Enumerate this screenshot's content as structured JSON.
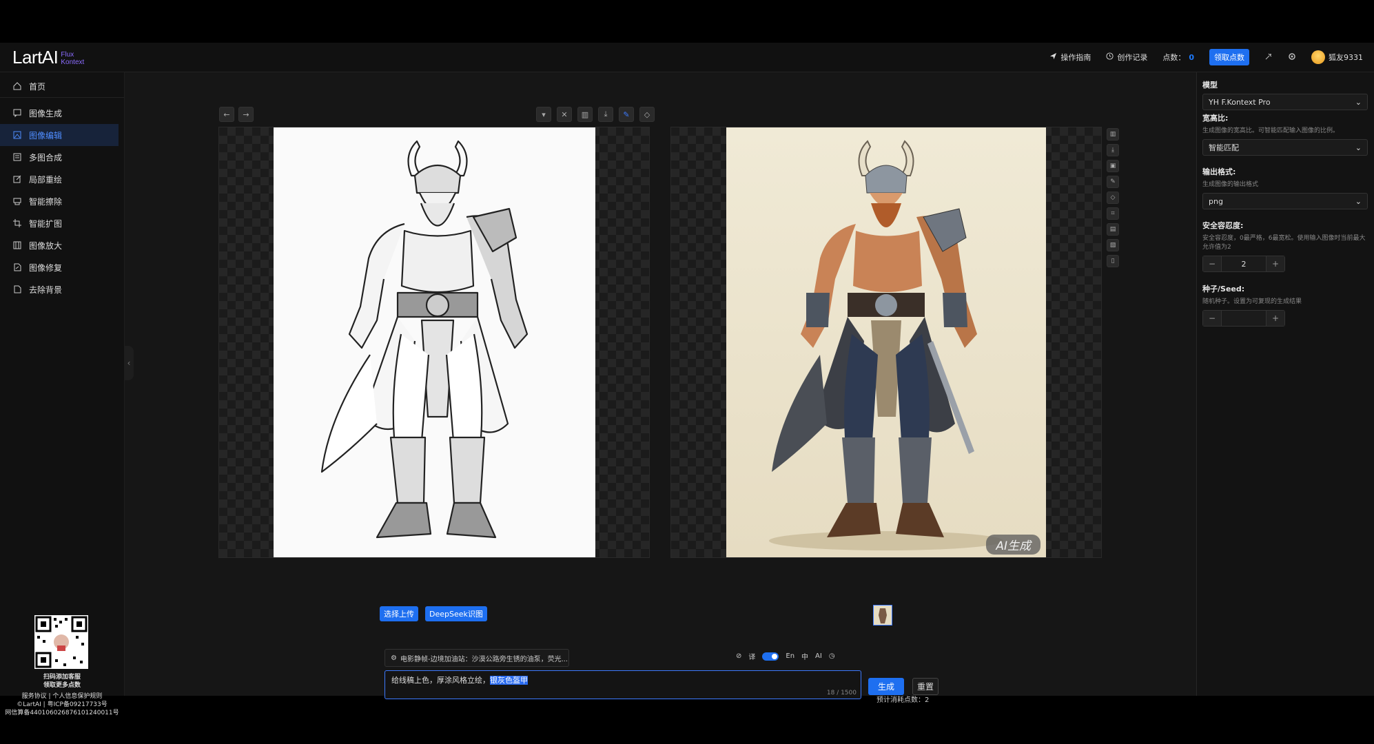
{
  "header": {
    "logo_main": "LartAI",
    "logo_sub_line1": "Flux",
    "logo_sub_line2": "Kontext",
    "guide": "操作指南",
    "history": "创作记录",
    "points_label": "点数：",
    "points_value": "0",
    "claim_button": "领取点数",
    "username": "狐友9331"
  },
  "sidebar": {
    "items": [
      {
        "label": "首页",
        "icon": "home-icon"
      },
      {
        "label": "图像生成",
        "icon": "chat-icon"
      },
      {
        "label": "图像编辑",
        "icon": "image-edit-icon"
      },
      {
        "label": "多图合成",
        "icon": "layers-icon"
      },
      {
        "label": "局部重绘",
        "icon": "edit-icon"
      },
      {
        "label": "智能擦除",
        "icon": "eraser-icon"
      },
      {
        "label": "智能扩图",
        "icon": "crop-icon"
      },
      {
        "label": "图像放大",
        "icon": "upscale-icon"
      },
      {
        "label": "图像修复",
        "icon": "repair-icon"
      },
      {
        "label": "去除背景",
        "icon": "file-icon"
      }
    ],
    "footer": {
      "qr_line1": "扫码添加客服",
      "qr_line2": "领取更多点数",
      "links": "服务协议 | 个人信息保护规则",
      "copyright": "©LartAI | 粤ICP备09217733号",
      "police": "网信算备440106026876101240011号"
    }
  },
  "editor": {
    "upload_button": "选择上传",
    "deepseek_button": "DeepSeek识图",
    "ai_badge": "AI生成"
  },
  "prompt": {
    "preset_text": "电影静帧-边境加油站：沙漠公路旁生锈的油泵，荧光...",
    "translate_label": "译",
    "lang_en": "En",
    "lang_zh": "中",
    "lang_ai": "AI",
    "text_normal": "给线稿上色，厚涂风格立绘，",
    "text_selected": "银灰色盔甲",
    "count": "18 / 1500",
    "generate_button": "生成",
    "reset_button": "重置",
    "cost": "预计消耗点数：2"
  },
  "settings": {
    "model_label": "模型",
    "model_value": "YH F.Kontext Pro",
    "ratio_label": "宽高比:",
    "ratio_desc": "生成图像的宽高比。可智能匹配输入图像的比例。",
    "ratio_value": "智能匹配",
    "format_label": "输出格式:",
    "format_desc": "生成图像的输出格式",
    "format_value": "png",
    "safety_label": "安全容忍度:",
    "safety_desc": "安全容忍度，0最严格，6最宽松。使用输入图像时当前最大允许值为2",
    "safety_value": "2",
    "seed_label": "种子/Seed:",
    "seed_desc": "随机种子。设置为可复现的生成结果",
    "seed_value": ""
  }
}
